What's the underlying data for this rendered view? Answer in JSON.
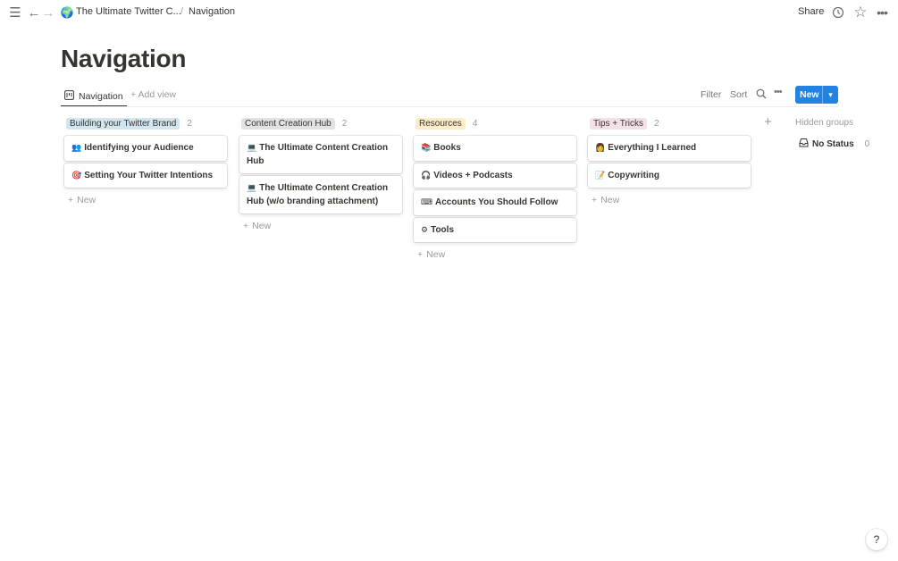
{
  "topbar": {
    "breadcrumb_parent": "The Ultimate Twitter C...",
    "breadcrumb_sep": "/",
    "breadcrumb_current": "Navigation",
    "share_label": "Share"
  },
  "page": {
    "title": "Navigation"
  },
  "viewbar": {
    "active_view": "Navigation",
    "add_view": "Add view",
    "filter": "Filter",
    "sort": "Sort",
    "new_button": "New"
  },
  "board": {
    "columns": [
      {
        "name": "Building your Twitter Brand",
        "count": "2",
        "color": "#d3e5ef",
        "cards": [
          {
            "icon": "👥",
            "title": "Identifying your Audience"
          },
          {
            "icon": "🎯",
            "title": "Setting Your Twitter Intentions"
          }
        ],
        "new_label": "New"
      },
      {
        "name": "Content Creation Hub",
        "count": "2",
        "color": "#e3e2e0",
        "cards": [
          {
            "icon": "💻",
            "title": "The Ultimate Content Creation Hub"
          },
          {
            "icon": "💻",
            "title": "The Ultimate Content Creation Hub (w/o branding attachment)"
          }
        ],
        "new_label": "New"
      },
      {
        "name": "Resources",
        "count": "4",
        "color": "#fdecc8",
        "cards": [
          {
            "icon": "📚",
            "title": "Books"
          },
          {
            "icon": "🎧",
            "title": "Videos + Podcasts"
          },
          {
            "icon": "⌨",
            "title": "Accounts You Should Follow"
          },
          {
            "icon": "⚙",
            "title": "Tools"
          }
        ],
        "new_label": "New"
      },
      {
        "name": "Tips + Tricks",
        "count": "2",
        "color": "#f5e0e9",
        "cards": [
          {
            "icon": "👩",
            "title": "Everything I Learned"
          },
          {
            "icon": "📝",
            "title": "Copywriting"
          }
        ],
        "new_label": "New"
      }
    ],
    "hidden_groups_label": "Hidden groups",
    "no_status_label": "No Status",
    "no_status_count": "0"
  },
  "help_label": "?"
}
